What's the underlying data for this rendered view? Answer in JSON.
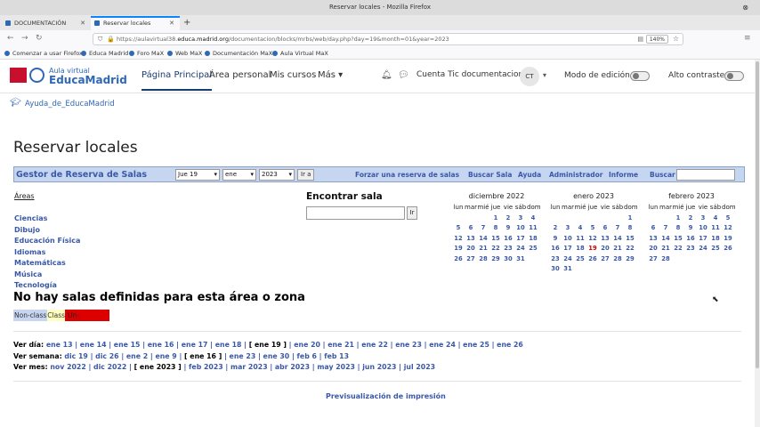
{
  "window": {
    "title": "Reservar locales - Mozilla Firefox"
  },
  "tabs": [
    {
      "label": "DOCUMENTACIÓN",
      "active": false
    },
    {
      "label": "Reservar locales",
      "active": true
    }
  ],
  "url": {
    "prefix": "https://aulavirtual38.",
    "domain": "educa.madrid.org",
    "path": "/documentacion/blocks/mrbs/web/day.php?day=19&month=01&year=2023",
    "zoom": "140%"
  },
  "bookmarks": [
    "Comenzar a usar Firefox",
    "Educa Madrid",
    "Foro MaX",
    "Web MaX",
    "Documentación MaX",
    "Aula Virtual MaX"
  ],
  "site": {
    "logo_line1": "Aula virtual",
    "logo_line2": "EducaMadrid",
    "nav": [
      "Página Principal",
      "Área personal",
      "Mis cursos",
      "Más"
    ],
    "user_name": "Cuenta Tic documentacion",
    "avatar": "CT",
    "edit_mode": "Modo de edición",
    "high_contrast": "Alto contraste"
  },
  "breadcrumb": "Ayuda_de_EducaMadrid",
  "page_title": "Reservar locales",
  "mrbs": {
    "title": "Gestor de Reserva de Salas",
    "day": "Jue 19",
    "month": "ene",
    "year": "2023",
    "go": "Ir a",
    "links": [
      "Forzar una reserva de salas",
      "Buscar Sala",
      "Ayuda",
      "Administrador",
      "Informe",
      "Buscar"
    ]
  },
  "areas": {
    "heading": "Áreas",
    "items": [
      "Ciencias",
      "Dibujo",
      "Educación Física",
      "Idiomas",
      "Matemáticas",
      "Música",
      "Tecnología"
    ]
  },
  "find_room": {
    "title": "Encontrar sala",
    "button": "Ir"
  },
  "calendars": {
    "weekdays": [
      "lun",
      "mar",
      "mié",
      "jue",
      "vie",
      "sáb",
      "dom"
    ],
    "months": [
      {
        "name": "diciembre 2022",
        "weeks": [
          [
            "",
            "",
            "",
            "1",
            "2",
            "3",
            "4"
          ],
          [
            "5",
            "6",
            "7",
            "8",
            "9",
            "10",
            "11"
          ],
          [
            "12",
            "13",
            "14",
            "15",
            "16",
            "17",
            "18"
          ],
          [
            "19",
            "20",
            "21",
            "22",
            "23",
            "24",
            "25"
          ],
          [
            "26",
            "27",
            "28",
            "29",
            "30",
            "31",
            ""
          ]
        ]
      },
      {
        "name": "enero 2023",
        "weeks": [
          [
            "",
            "",
            "",
            "",
            "",
            "",
            "1"
          ],
          [
            "2",
            "3",
            "4",
            "5",
            "6",
            "7",
            "8"
          ],
          [
            "9",
            "10",
            "11",
            "12",
            "13",
            "14",
            "15"
          ],
          [
            "16",
            "17",
            "18",
            "19",
            "20",
            "21",
            "22"
          ],
          [
            "23",
            "24",
            "25",
            "26",
            "27",
            "28",
            "29"
          ],
          [
            "30",
            "31",
            "",
            "",
            "",
            "",
            ""
          ]
        ],
        "today": "19"
      },
      {
        "name": "febrero 2023",
        "weeks": [
          [
            "",
            "",
            "1",
            "2",
            "3",
            "4",
            "5"
          ],
          [
            "6",
            "7",
            "8",
            "9",
            "10",
            "11",
            "12"
          ],
          [
            "13",
            "14",
            "15",
            "16",
            "17",
            "18",
            "19"
          ],
          [
            "20",
            "21",
            "22",
            "23",
            "24",
            "25",
            "26"
          ],
          [
            "27",
            "28",
            "",
            "",
            "",
            "",
            ""
          ]
        ]
      }
    ]
  },
  "no_rooms_msg": "No hay salas definidas para esta área o zona",
  "legend": {
    "non_class": "Non-class",
    "class": "Class",
    "class_red": "Un-confirmed"
  },
  "views": {
    "day_label": "Ver día:",
    "days": [
      "ene 13",
      "ene 14",
      "ene 15",
      "ene 16",
      "ene 17",
      "ene 18",
      "[ ene 19 ]",
      "ene 20",
      "ene 21",
      "ene 22",
      "ene 23",
      "ene 24",
      "ene 25",
      "ene 26"
    ],
    "week_label": "Ver semana:",
    "weeks": [
      "dic 19",
      "dic 26",
      "ene 2",
      "ene 9",
      "[ ene 16 ]",
      "ene 23",
      "ene 30",
      "feb 6",
      "feb 13"
    ],
    "month_label": "Ver mes:",
    "months": [
      "nov 2022",
      "dic 2022",
      "[ ene 2023 ]",
      "feb 2023",
      "mar 2023",
      "abr 2023",
      "may 2023",
      "jun 2023",
      "jul 2023"
    ]
  },
  "print_preview": "Previsualización de impresión"
}
